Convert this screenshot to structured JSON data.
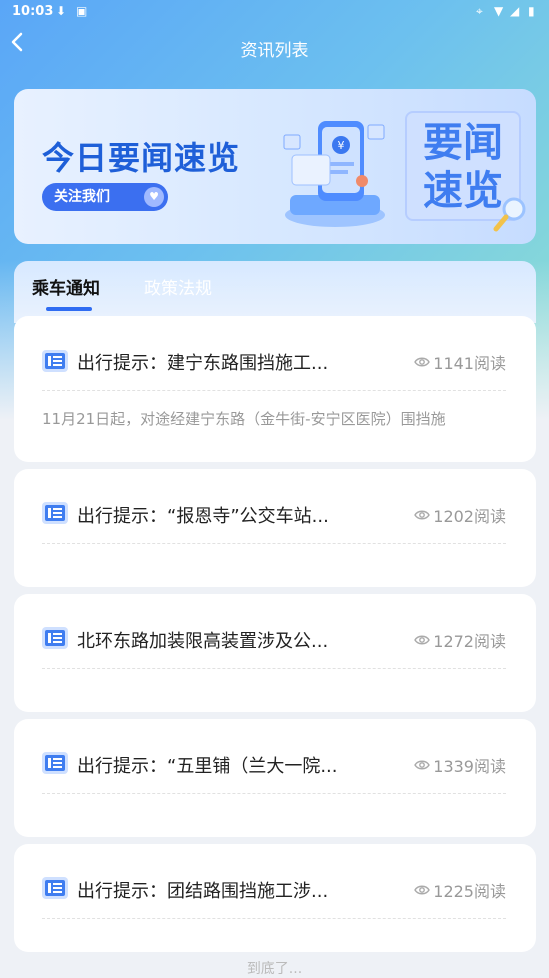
{
  "status_bar": {
    "time": "10:03"
  },
  "header": {
    "title": "资讯列表"
  },
  "banner": {
    "title": "今日要闻速览",
    "follow_label": "关注我们",
    "badge_line1": "要闻",
    "badge_line2": "速览"
  },
  "tabs": [
    {
      "label": "乘车通知",
      "active": true
    },
    {
      "label": "政策法规",
      "active": false
    }
  ],
  "news": [
    {
      "title": "出行提示：建宁东路围挡施工...",
      "views": "1141阅读",
      "desc": "11月21日起，对途经建宁东路（金牛街-安宁区医院）围挡施"
    },
    {
      "title": "出行提示：“报恩寺”公交车站...",
      "views": "1202阅读",
      "desc": ""
    },
    {
      "title": "北环东路加装限高装置涉及公...",
      "views": "1272阅读",
      "desc": ""
    },
    {
      "title": "出行提示：“五里铺（兰大一院...",
      "views": "1339阅读",
      "desc": ""
    },
    {
      "title": "出行提示：团结路围挡施工涉...",
      "views": "1225阅读",
      "desc": ""
    }
  ],
  "footer": {
    "text": "到底了..."
  },
  "colors": {
    "accent": "#2f6cf2",
    "banner_title": "#1e5fd8"
  }
}
